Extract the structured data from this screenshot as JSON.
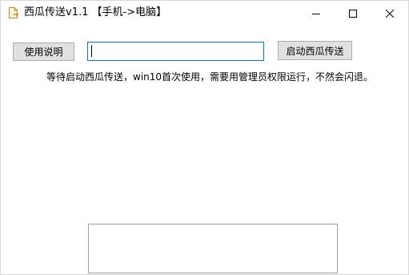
{
  "window": {
    "title": "西瓜传送v1.1 【手机->电脑】",
    "app_icon": "document-arrow-icon",
    "controls": {
      "minimize_icon": "minimize-icon",
      "maximize_icon": "maximize-icon",
      "close_icon": "close-icon"
    }
  },
  "toolbar": {
    "help_label": "使用说明",
    "input_value": "",
    "start_label": "启动西瓜传送"
  },
  "notice": "等待启动西瓜传送，win10首次使用，需要用管理员权限运行，不然会闪退。",
  "output": {
    "text": ""
  },
  "colors": {
    "button_bg": "#e1e1e1",
    "input_focus_border": "#0078d7",
    "window_bg": "#ffffff"
  }
}
